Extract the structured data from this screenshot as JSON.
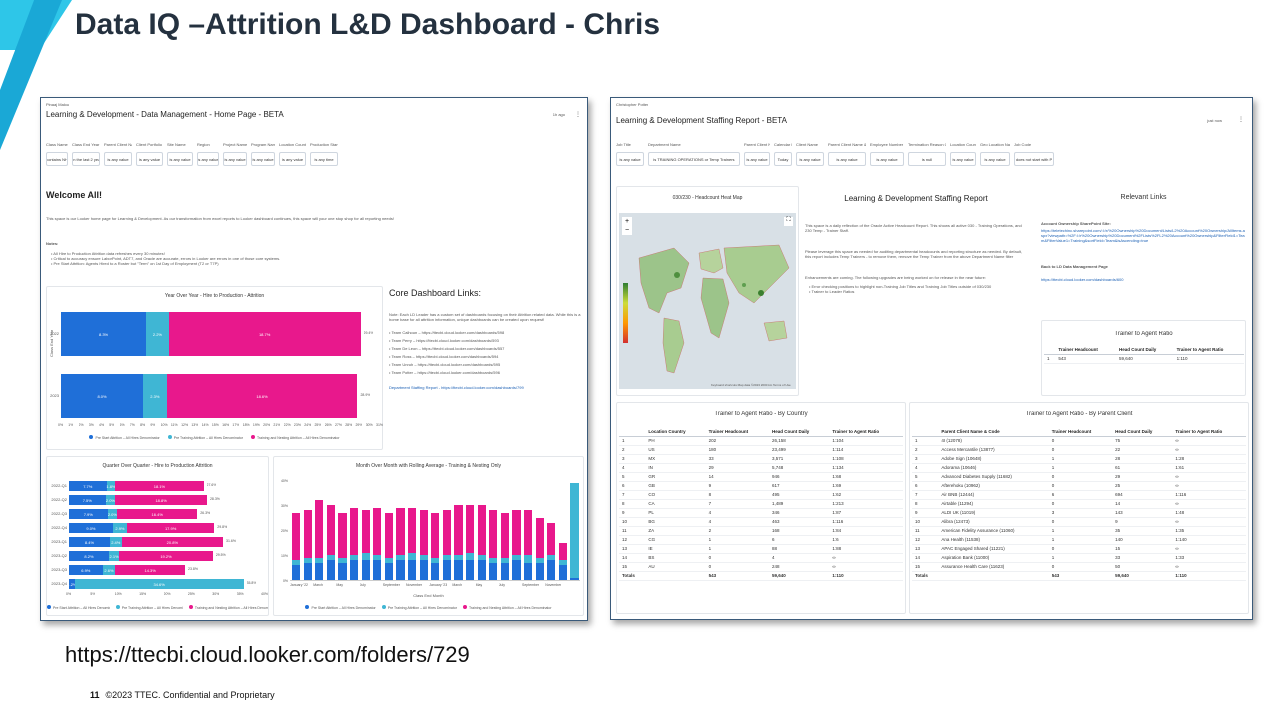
{
  "slide": {
    "title": "Data IQ –Attrition L&D Dashboard - Chris",
    "url": "https://ttecbi.cloud.looker.com/folders/729",
    "page_number": "11",
    "footer": "©2023 TTEC. Confidential and Proprietary"
  },
  "left": {
    "owner": "Pinaaj Malou",
    "title": "Learning & Development - Data Management - Home Page - BETA",
    "topright": "1h ago",
    "filters": [
      {
        "label": "Class Name",
        "value": "contains NH"
      },
      {
        "label": "Class End Year",
        "value": "is in the last 2 years"
      },
      {
        "label": "Parent Client Name",
        "value": "is any value"
      },
      {
        "label": "Client Portfolio",
        "value": "is any value"
      },
      {
        "label": "Site Name",
        "value": "is any value"
      },
      {
        "label": "Region",
        "value": "is any value"
      },
      {
        "label": "Project Name",
        "value": "is any value"
      },
      {
        "label": "Program Name",
        "value": "is any value"
      },
      {
        "label": "Location Country",
        "value": "is any value"
      },
      {
        "label": "Production Start Date",
        "value": "is any time"
      }
    ],
    "welcome": "Welcome All!",
    "welcome_text": "This space is our Looker home page for Learning & Development. As our transformation from excel reports to Looker dashboard continues, this space will your one stop shop for all reporting needs!",
    "notes_label": "Notes:",
    "notes": [
      "All Hire to Production Attrition data refreshes every 30 minutes!",
      "Critical to accuracy ensure LaborPoint, ADT7, and Oracle are accurate, errors in Looker are errors in one of those core systems.",
      "Pre Start Attrition: Agents Hired to a Roster but \"Term\" on 1st Day of Employment (T2 or T7P)"
    ],
    "yoy": {
      "title": "Year Over Year - Hire to Production - Attrition",
      "ylabel": "Class End Year",
      "rows": [
        {
          "label": "2022",
          "values": [
            8.3,
            2.2,
            18.7
          ],
          "total": "29.4%",
          "labels": [
            "8.3%",
            "2.2%",
            "18.7%"
          ]
        },
        {
          "label": "2023",
          "values": [
            8.0,
            2.3,
            18.6
          ],
          "total": "28.9%",
          "labels": [
            "8.0%",
            "2.3%",
            "18.6%"
          ]
        }
      ],
      "ticks": [
        "0%",
        "1%",
        "2%",
        "3%",
        "4%",
        "5%",
        "6%",
        "7%",
        "8%",
        "9%",
        "10%",
        "11%",
        "12%",
        "13%",
        "14%",
        "15%",
        "16%",
        "17%",
        "18%",
        "19%",
        "20%",
        "21%",
        "22%",
        "23%",
        "24%",
        "25%",
        "26%",
        "27%",
        "28%",
        "29%",
        "30%",
        "31%"
      ],
      "legend": [
        "Pre Start Attrition – All Hires Denominator",
        "Pre Training Attrition – All Hires Denominator",
        "Training and Nesting Attrition – All Hires Denominator"
      ]
    },
    "core_links": {
      "title": "Core Dashboard Links:",
      "note": "Note: Each LD Leader has a custom set of dashboards focusing on their Attrition related data. While this is a home base for all attrition information, unique dashboards can be created upon request!",
      "items": [
        "Team Calhoun – https://ttecbi.cloud.looker.com/dashboards/598",
        "Team Perry – https://ttecbi.cloud.looker.com/dashboards/593",
        "Team De Leon – https://ttecbi.cloud.looker.com/dashboards/557",
        "Team Ross – https://ttecbi.cloud.looker.com/dashboards/594",
        "Team Unruh – https://ttecbi.cloud.looker.com/dashboards/595",
        "Team Potter – https://ttecbi.cloud.looker.com/dashboards/596"
      ],
      "staffing": "Department Staffing Report - https://ttecbi.cloud.looker.com/dashboards/799"
    },
    "qoq": {
      "title": "Quarter Over Quarter - Hire to Production Attrition",
      "rows": [
        {
          "label": "2022-Q1",
          "vals": [
            7.7,
            1.8,
            18.1
          ],
          "labels": [
            "7.7%",
            "1.8%",
            "18.1%"
          ],
          "total": "27.6%"
        },
        {
          "label": "2022-Q2",
          "vals": [
            7.5,
            2.0,
            18.8
          ],
          "labels": [
            "7.5%",
            "2.0%",
            "18.8%"
          ],
          "total": "28.3%"
        },
        {
          "label": "2022-Q3",
          "vals": [
            7.9,
            2.0,
            16.4
          ],
          "labels": [
            "7.9%",
            "2.0%",
            "16.4%"
          ],
          "total": "26.3%"
        },
        {
          "label": "2022-Q4",
          "vals": [
            9.0,
            2.9,
            17.9
          ],
          "labels": [
            "9.0%",
            "2.9%",
            "17.9%"
          ],
          "total": "29.8%"
        },
        {
          "label": "2023-Q1",
          "vals": [
            8.4,
            2.4,
            20.8
          ],
          "labels": [
            "8.4%",
            "2.4%",
            "20.8%"
          ],
          "total": "31.6%"
        },
        {
          "label": "2023-Q2",
          "vals": [
            8.2,
            2.1,
            19.2
          ],
          "labels": [
            "8.2%",
            "2.1%",
            "19.2%"
          ],
          "total": "29.5%"
        },
        {
          "label": "2023-Q3",
          "vals": [
            6.9,
            2.6,
            14.3
          ],
          "labels": [
            "6.9%",
            "2.6%",
            "14.3%"
          ],
          "total": "23.8%"
        },
        {
          "label": "2023-Q4",
          "vals": [
            1.2,
            34.6,
            0
          ],
          "labels": [
            "1.2%",
            "34.6%",
            ""
          ],
          "total": "35.8%"
        }
      ],
      "ticks": [
        "0%",
        "5%",
        "10%",
        "15%",
        "20%",
        "25%",
        "30%",
        "35%",
        "40%"
      ],
      "legend": [
        "Pre Start Attrition – All Hires Denominator",
        "Pre Training Attrition – All Hires Denominator",
        "Training and Nesting Attrition – All Hires Denominator"
      ]
    },
    "mom": {
      "title": "Month Over Month with Rolling Average - Training & Nesting Only",
      "xlabel": "Class End Month",
      "yticks": [
        "0%",
        "10%",
        "20%",
        "30%",
        "40%"
      ],
      "xticks": [
        "January '22",
        "March",
        "May",
        "July",
        "September",
        "November",
        "January '23",
        "March",
        "May",
        "July",
        "September",
        "November"
      ],
      "months": [
        [
          6,
          2,
          19
        ],
        [
          7,
          2,
          19
        ],
        [
          7,
          2,
          23
        ],
        [
          8,
          2,
          20
        ],
        [
          7,
          2,
          18
        ],
        [
          8,
          2,
          19
        ],
        [
          8,
          3,
          17
        ],
        [
          8,
          2,
          19
        ],
        [
          7,
          2,
          18
        ],
        [
          8,
          2,
          19
        ],
        [
          8,
          3,
          18
        ],
        [
          8,
          2,
          18
        ],
        [
          7,
          2,
          18
        ],
        [
          8,
          2,
          18
        ],
        [
          8,
          2,
          20
        ],
        [
          8,
          3,
          19
        ],
        [
          8,
          2,
          20
        ],
        [
          7,
          2,
          19
        ],
        [
          7,
          2,
          18
        ],
        [
          8,
          2,
          18
        ],
        [
          7,
          3,
          18
        ],
        [
          7,
          2,
          16
        ],
        [
          8,
          2,
          13
        ],
        [
          6,
          2,
          7
        ],
        [
          1,
          38,
          0
        ]
      ],
      "legend": [
        "Pre Start Attrition – All Hires Denominator",
        "Pre Training Attrition – All Hires Denominator",
        "Training and Nesting Attrition – All Hires Denominator"
      ]
    }
  },
  "right": {
    "owner": "Christopher Potter",
    "title": "Learning & Development Staffing Report - BETA",
    "topright": "just now",
    "filters": [
      {
        "label": "Job Title",
        "value": "is any value"
      },
      {
        "label": "Department Name",
        "value": "is TRAINING OPERATIONS or Temp Trainers"
      },
      {
        "label": "Parent Client Name",
        "value": "is any value"
      },
      {
        "label": "Calendar Date",
        "value": "Today"
      },
      {
        "label": "Client Name",
        "value": "is any value"
      },
      {
        "label": "Parent Client Name & Code",
        "value": "is any value"
      },
      {
        "label": "Employee Number",
        "value": "is any value"
      },
      {
        "label": "Termination Reason Code",
        "value": "is null"
      },
      {
        "label": "Location Country",
        "value": "is any value"
      },
      {
        "label": "Geo Location Name",
        "value": "is any value"
      },
      {
        "label": "Job Code",
        "value": "does not start with P"
      }
    ],
    "map_title": "030/230 - Headcount Heat Map",
    "map_credit": "Keyboard shortcuts  Map data ©2023  2000 km  Terms of Use",
    "report_title": "Learning & Development Staffing Report",
    "report_p1": "This space is a daily reflection of the Oracle Active Headcount Report. This shows all active 030 - Training Operations, and 230 Temp - Trainer Staff.",
    "report_p2": "Please leverage this space as needed for auditing departmental headcounts and reporting structure as needed. By default, this report includes Temp Trainers - to remove them, remove the Temp Trainer from the above Department Name filter",
    "report_p3": "Enhancements are coming. The following upgrades are being worked on for release in the near future:",
    "report_bullets": [
      "Error checking positions to highlight non-Training Job Titles and Training Job Titles outside of 030/230",
      "Trainer to Leader Ratios"
    ],
    "links_title": "Relevant Links",
    "sp_label": "Account Ownership SharePoint Site:",
    "sp_url": "https://teletechinc.sharepoint.com/:l:/r/%20Ownership%20Document/Lists/L2%20Account%20Ownership/AllItems.aspx?viewpath=%2F:l:/r%20Ownership%20Document%2FLists%2FL2%20Account%20Ownership&FilterField1=Team&FilterValue1=Training&sortField=Team&isAscending=true",
    "back_label": "Back to LD Data Management Page",
    "back_url": "https://ttecbi.cloud.looker.com/dashboards/600",
    "ratio": {
      "title": "Trainer to Agent Ratio",
      "headers": [
        "Trainer Headcount",
        "Head Count Daily",
        "Trainer to Agent Ratio"
      ],
      "row": [
        "1",
        "543",
        "59,640",
        "1:110"
      ]
    },
    "country": {
      "title": "Trainer to Agent Ratio - By Country",
      "headers": [
        "",
        "Location Country",
        "Trainer Headcount",
        "Head Count Daily",
        "Trainer to Agent Ratio"
      ],
      "rows": [
        [
          "1",
          "PH",
          "202",
          "26,158",
          "1:104"
        ],
        [
          "2",
          "US",
          "180",
          "23,499",
          "1:114"
        ],
        [
          "3",
          "MX",
          "33",
          "3,571",
          "1:108"
        ],
        [
          "4",
          "IN",
          "29",
          "5,748",
          "1:134"
        ],
        [
          "5",
          "GR",
          "14",
          "946",
          "1:68"
        ],
        [
          "6",
          "GB",
          "9",
          "617",
          "1:69"
        ],
        [
          "7",
          "CO",
          "8",
          "495",
          "1:62"
        ],
        [
          "8",
          "CA",
          "7",
          "1,489",
          "1:213"
        ],
        [
          "9",
          "PL",
          "4",
          "346",
          "1:87"
        ],
        [
          "10",
          "BG",
          "4",
          "463",
          "1:116"
        ],
        [
          "11",
          "ZA",
          "2",
          "168",
          "1:84"
        ],
        [
          "12",
          "CG",
          "1",
          "6",
          "1:6"
        ],
        [
          "13",
          "IE",
          "1",
          "88",
          "1:88"
        ],
        [
          "14",
          "BS",
          "0",
          "4",
          "∞"
        ],
        [
          "15",
          "AU",
          "0",
          "248",
          "∞"
        ]
      ],
      "totals": [
        "Totals",
        "",
        "543",
        "59,640",
        "1:110"
      ]
    },
    "parent": {
      "title": "Trainer to Agent Ratio - By Parent Client",
      "headers": [
        "",
        "Parent Client Name & Code",
        "Trainer Headcount",
        "Head Count Daily",
        "Trainer to Agent Ratio"
      ],
      "rows": [
        [
          "1",
          "4I (12078)",
          "0",
          "75",
          "∞"
        ],
        [
          "2",
          "Access Mercantile (13877)",
          "0",
          "22",
          "∞"
        ],
        [
          "3",
          "Adobe Sign (10648)",
          "1",
          "28",
          "1:28"
        ],
        [
          "4",
          "Adorama (10646)",
          "1",
          "61",
          "1:61"
        ],
        [
          "5",
          "Advanced Diabetes Supply (11682)",
          "0",
          "29",
          "∞"
        ],
        [
          "6",
          "Afterehoku (10962)",
          "0",
          "25",
          "∞"
        ],
        [
          "7",
          "Air BNB (12444)",
          "6",
          "694",
          "1:116"
        ],
        [
          "8",
          "Airtable (11294)",
          "0",
          "14",
          "∞"
        ],
        [
          "9",
          "ALDI UK (11019)",
          "3",
          "143",
          "1:48"
        ],
        [
          "10",
          "Alibra (12473)",
          "0",
          "9",
          "∞"
        ],
        [
          "11",
          "American Fidelity Assurance (11060)",
          "1",
          "35",
          "1:35"
        ],
        [
          "12",
          "Ana Health (11538)",
          "1",
          "140",
          "1:140"
        ],
        [
          "13",
          "APAC Engaged Shared (11221)",
          "0",
          "15",
          "∞"
        ],
        [
          "14",
          "Aspiration Bank (11000)",
          "1",
          "33",
          "1:33"
        ],
        [
          "15",
          "Assurance Health Care (11623)",
          "0",
          "50",
          "∞"
        ]
      ],
      "totals": [
        "Totals",
        "",
        "543",
        "59,640",
        "1:110"
      ]
    }
  },
  "colors": {
    "pre_start": "#1f6fd8",
    "pre_training": "#3fb6d4",
    "training": "#e8188c",
    "title": "#24313f"
  }
}
